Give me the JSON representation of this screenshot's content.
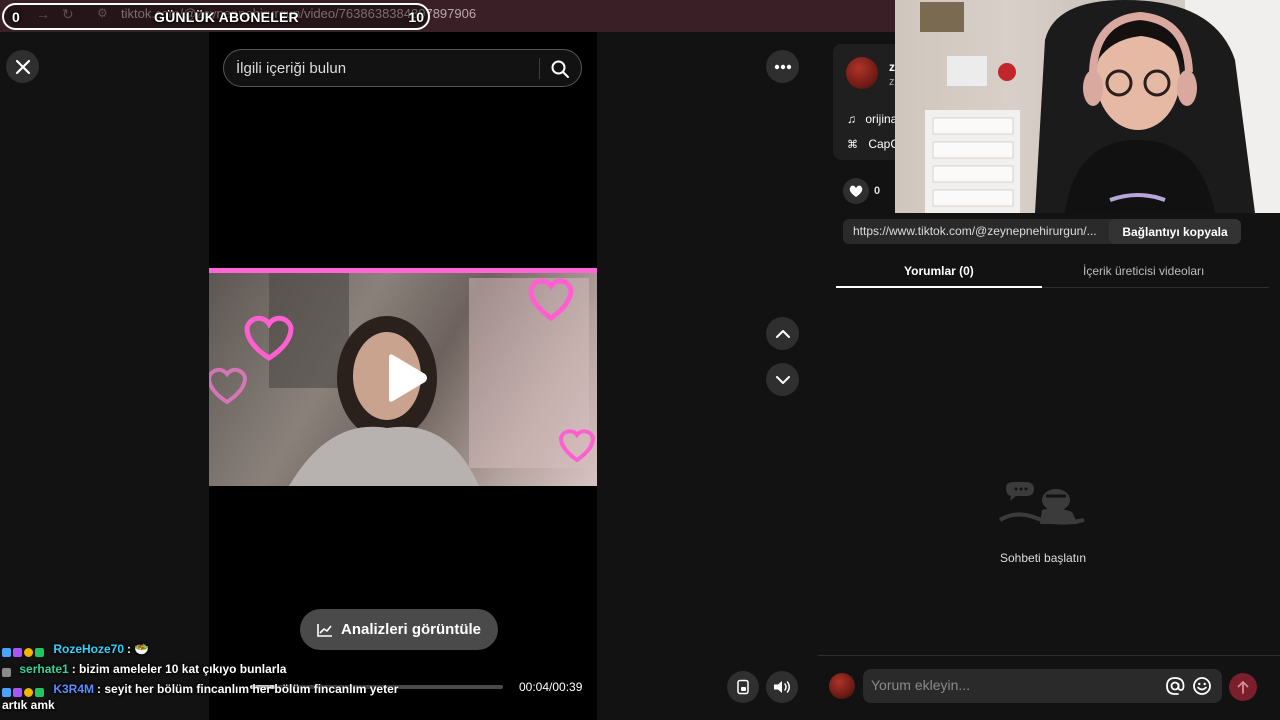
{
  "browser": {
    "url": "tiktok.com/@zeynepnehirurgun/video/7638638384897897906"
  },
  "goal_overlay": {
    "current": "0",
    "label": "GÜNLÜK ABONELER",
    "target": "10"
  },
  "viewer": {
    "search_placeholder": "İlgili içeriği bulun",
    "analytics_label": "Analizleri görüntüle",
    "time": "00:04/00:39",
    "progress_fraction": 0.1
  },
  "chat": [
    {
      "user": "RozeHoze70",
      "user_color": "#2fd3ff",
      "message": ": 🥗"
    },
    {
      "user": "serhate1",
      "user_color": "#34d399",
      "message": ": bizim ameleler 10 kat çıkıyo bunlarla"
    },
    {
      "user": "K3R4M",
      "user_color": "#5b8cff",
      "message": ": seyit her bölüm fincanlım her bölüm fincanlım yeter artık amk"
    }
  ],
  "panel": {
    "author_initial": "z",
    "author_sub": "z",
    "music_text": "orijina",
    "capcut_text": "CapC",
    "like_count": "0",
    "link_text": "https://www.tiktok.com/@zeynepnehirurgun/...",
    "copy_label": "Bağlantıyı kopyala",
    "tab_comments": "Yorumlar (0)",
    "tab_creator": "İçerik üreticisi videoları",
    "empty_text": "Sohbeti başlatın",
    "comment_placeholder": "Yorum ekleyin..."
  },
  "colors": {
    "accent": "#fe2c55",
    "panel_bg": "#121212",
    "button_bg": "#2f2f2f"
  }
}
